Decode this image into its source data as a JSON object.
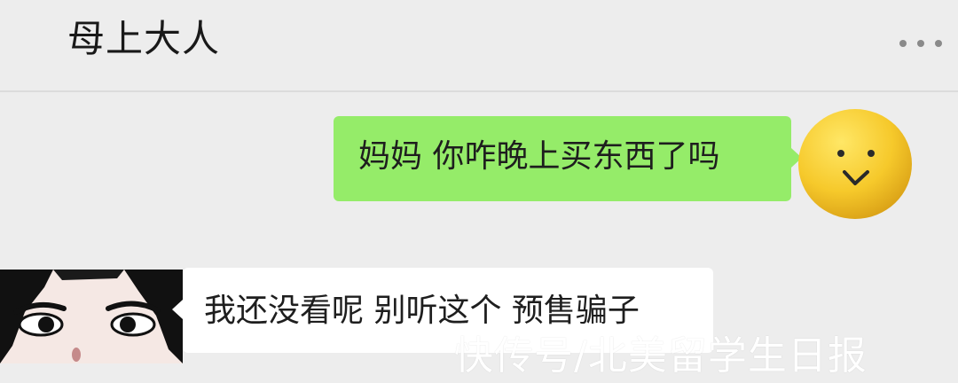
{
  "header": {
    "title": "母上大人",
    "more_icon": "more-dots-icon"
  },
  "messages": [
    {
      "direction": "outgoing",
      "text": "妈妈 你咋晚上买东西了吗",
      "avatar": "smiley-emoji-avatar"
    },
    {
      "direction": "incoming",
      "text": "我还没看呢 别听这个 预售骗子",
      "avatar": "cartoon-face-avatar"
    }
  ],
  "watermark": "快传号/北美留学生日报",
  "colors": {
    "background": "#ededed",
    "outgoing_bubble": "#95ec69",
    "incoming_bubble": "#ffffff",
    "text": "#1e1e1e"
  }
}
